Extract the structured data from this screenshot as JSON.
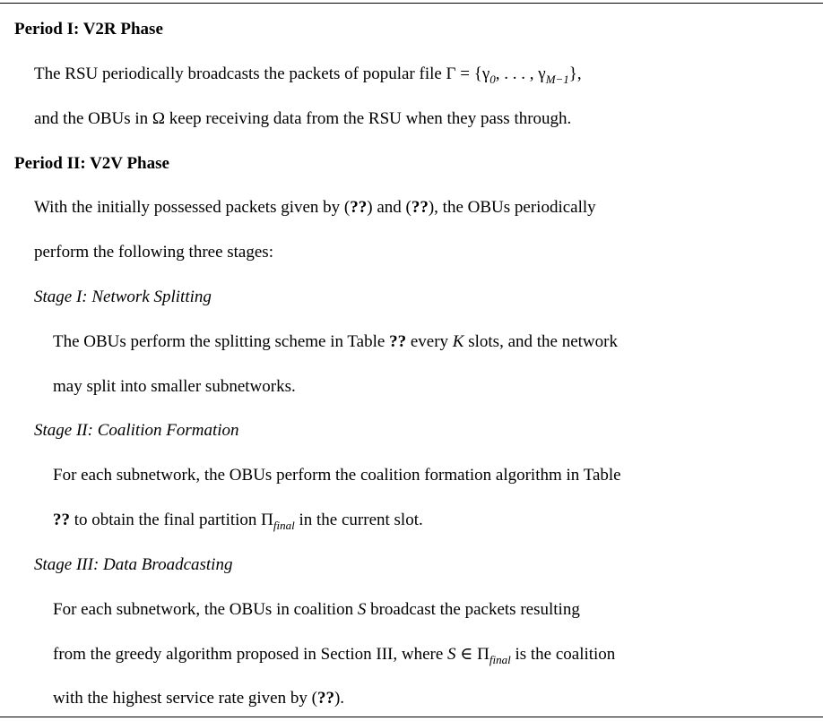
{
  "period1": {
    "heading": "Period I: V2R Phase",
    "line1_pre": "The RSU periodically broadcasts the packets of popular file Γ = {γ",
    "line1_sub0": "0",
    "line1_mid": ", . . . , γ",
    "line1_sub1": "M−1",
    "line1_post": "},",
    "line2": "and the OBUs in Ω keep receiving data from the RSU when they pass through."
  },
  "period2": {
    "heading": "Period II: V2V Phase",
    "line1_a": "With the initially possessed packets given by (",
    "line1_ref1": "??",
    "line1_b": ") and (",
    "line1_ref2": "??",
    "line1_c": "), the OBUs periodically",
    "line2": "perform the following three stages:"
  },
  "stage1": {
    "title": "Stage I: Network Splitting",
    "line1_a": "The OBUs perform the splitting scheme in Table ",
    "line1_ref": "??",
    "line1_b": " every ",
    "line1_var": "K",
    "line1_c": " slots, and the network",
    "line2": "may split into smaller subnetworks."
  },
  "stage2": {
    "title": "Stage II: Coalition Formation",
    "line1": "For each subnetwork, the OBUs perform the coalition formation algorithm in Table",
    "line2_ref": "??",
    "line2_a": " to obtain the final partition Π",
    "line2_sub": "final",
    "line2_b": " in the current slot."
  },
  "stage3": {
    "title": "Stage III: Data Broadcasting",
    "line1_a": "For each subnetwork, the OBUs in coalition ",
    "line1_var": "S",
    "line1_b": " broadcast the packets resulting",
    "line2_a": "from the greedy algorithm proposed in Section III, where ",
    "line2_var": "S",
    "line2_b": " ∈ Π",
    "line2_sub": "final",
    "line2_c": " is the coalition",
    "line3_a": "with the highest service rate given by (",
    "line3_ref": "??",
    "line3_b": ")."
  }
}
